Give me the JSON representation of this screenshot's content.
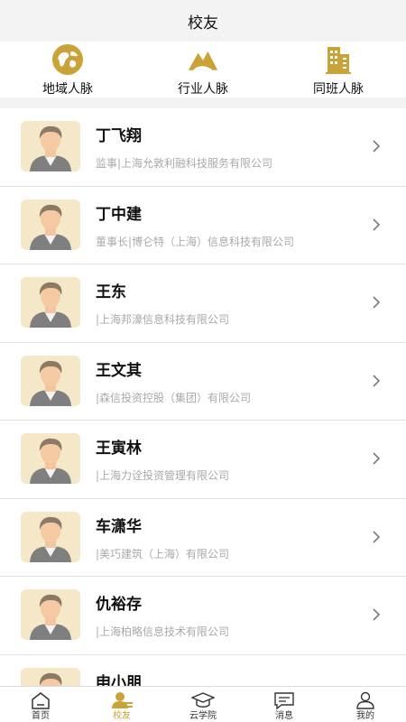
{
  "header": {
    "title": "校友"
  },
  "quick_links": [
    {
      "label": "地域人脉",
      "icon": "globe-icon"
    },
    {
      "label": "行业人脉",
      "icon": "mountain-icon"
    },
    {
      "label": "同班人脉",
      "icon": "building-icon"
    }
  ],
  "accent_color": "#c9a337",
  "alumni": [
    {
      "name": "丁飞翔",
      "detail": "监事|上海允敦利融科技服务有限公司"
    },
    {
      "name": "丁中建",
      "detail": "董事长|博仑特（上海）信息科技有限公司"
    },
    {
      "name": "王东",
      "detail": "|上海邦濠信息科技有限公司"
    },
    {
      "name": "王文其",
      "detail": "|森信投资控股（集团）有限公司"
    },
    {
      "name": "王寅林",
      "detail": "|上海力诠投资管理有限公司"
    },
    {
      "name": "车潇华",
      "detail": "|美巧建筑（上海）有限公司"
    },
    {
      "name": "仇裕存",
      "detail": "|上海柏略信息技术有限公司"
    },
    {
      "name": "申小朋",
      "detail": ""
    }
  ],
  "tabs": [
    {
      "label": "首页",
      "icon": "home-icon",
      "active": false
    },
    {
      "label": "校友",
      "icon": "alumni-icon",
      "active": true
    },
    {
      "label": "云学院",
      "icon": "graduation-cap-icon",
      "active": false
    },
    {
      "label": "消息",
      "icon": "message-icon",
      "active": false
    },
    {
      "label": "我的",
      "icon": "profile-icon",
      "active": false
    }
  ]
}
